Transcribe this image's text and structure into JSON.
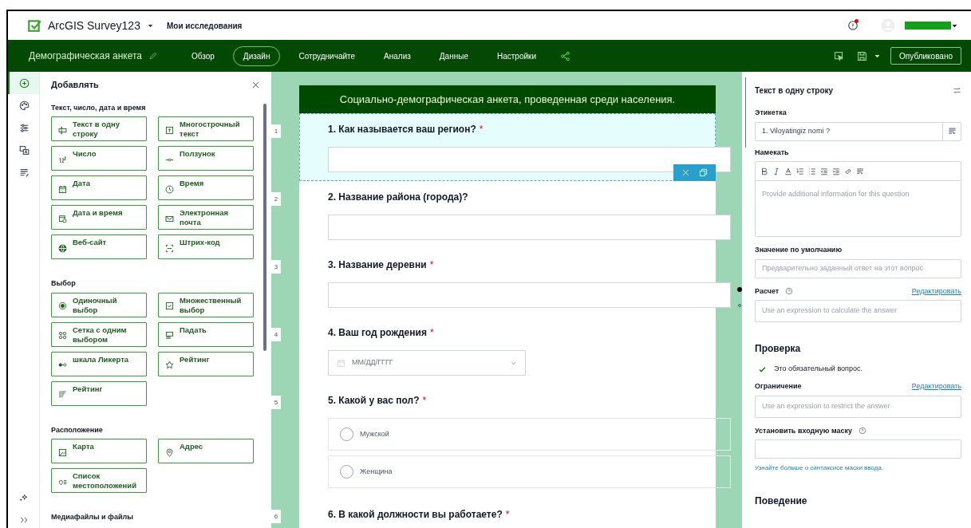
{
  "header": {
    "app_title": "ArcGIS Survey123",
    "my_surveys": "Мои исследования"
  },
  "navbar": {
    "survey_name": "Демографическая анкета",
    "tabs": [
      {
        "label": "Обзор",
        "selected": false
      },
      {
        "label": "Дизайн",
        "selected": true
      },
      {
        "label": "Сотрудничайте",
        "selected": false
      },
      {
        "label": "Анализ",
        "selected": false
      },
      {
        "label": "Данные",
        "selected": false
      },
      {
        "label": "Настройки",
        "selected": false
      }
    ],
    "publish_button": "Опубликовано"
  },
  "rail": {
    "items": [
      {
        "kind": "add",
        "selected": true
      },
      {
        "kind": "palette",
        "selected": false
      },
      {
        "kind": "sliders",
        "selected": false
      },
      {
        "kind": "translate",
        "selected": false
      },
      {
        "kind": "list",
        "selected": false
      }
    ],
    "bottom_items": [
      {
        "kind": "sparkle"
      },
      {
        "kind": "expand"
      }
    ]
  },
  "add_panel": {
    "title": "Добавлять",
    "sections": [
      {
        "title": "Текст, число, дата и время",
        "items": [
          {
            "label": "Текст в одну строку",
            "kind": "textline"
          },
          {
            "label": "Многострочный текст",
            "kind": "multiline"
          },
          {
            "label": "Число",
            "kind": "number"
          },
          {
            "label": "Ползунок",
            "kind": "slider"
          },
          {
            "label": "Дата",
            "kind": "date"
          },
          {
            "label": "Время",
            "kind": "time"
          },
          {
            "label": "Дата и время",
            "kind": "datetime"
          },
          {
            "label": "Электронная почта",
            "kind": "email"
          },
          {
            "label": "Веб-сайт",
            "kind": "web"
          },
          {
            "label": "Штрих-код",
            "kind": "barcode"
          }
        ]
      },
      {
        "title": "Выбор",
        "items": [
          {
            "label": "Одиночный выбор",
            "kind": "radio"
          },
          {
            "label": "Множественный выбор",
            "kind": "check"
          },
          {
            "label": "Сетка с одним выбором",
            "kind": "grid"
          },
          {
            "label": "Падать",
            "kind": "dropdown"
          },
          {
            "label": "шкала Ликерта",
            "kind": "likert"
          },
          {
            "label": "Рейтинг",
            "kind": "star"
          },
          {
            "label": "Рейтинг",
            "kind": "ranking"
          }
        ]
      },
      {
        "title": "Расположение",
        "items": [
          {
            "label": "Карта",
            "kind": "map"
          },
          {
            "label": "Адрес",
            "kind": "pin"
          },
          {
            "label": "Список местоположений",
            "kind": "loclist"
          }
        ]
      },
      {
        "title": "Медиафайлы и файлы"
      }
    ]
  },
  "canvas": {
    "form_title": "Социально-демографическая анкета, проведенная среди населения.",
    "questions": [
      {
        "number": "1",
        "label": "1. Как называется ваш регион?",
        "required_mark": "*",
        "kind": "text",
        "selected": true
      },
      {
        "number": "2",
        "label": "2. Название района (города)?",
        "kind": "text",
        "selected": false
      },
      {
        "number": "3",
        "label": "3. Название деревни",
        "required_mark": "*",
        "kind": "text",
        "selected": false
      },
      {
        "number": "4",
        "label": "4. Ваш год рождения",
        "required_mark": "*",
        "kind": "date",
        "placeholder": "ММ/ДД/ГГГГ",
        "selected": false
      },
      {
        "number": "5",
        "label": "5. Какой у вас пол?",
        "required_mark": "*",
        "kind": "radio",
        "options": [
          "Мужской",
          "Женщина"
        ],
        "selected": false
      },
      {
        "number": "6",
        "label": "6. В какой должности вы работаете?",
        "required_mark": "*",
        "kind": "partial",
        "selected": false
      }
    ]
  },
  "properties": {
    "title": "Текст в одну строку",
    "label_field": {
      "label": "Этикетка",
      "value": "1. Viloyatingiz nomi ?"
    },
    "hint_field": {
      "label": "Намекать",
      "placeholder": "Provide additional information for this question"
    },
    "default_field": {
      "label": "Значение по умолчанию",
      "placeholder": "Предварительно заданный ответ на этот вопрос"
    },
    "calculation": {
      "label": "Расчет",
      "link": "Редактировать",
      "placeholder": "Use an expression to calculate the answer"
    },
    "validation_title": "Проверка",
    "required_checkbox": {
      "label": "Это обязательный вопрос.",
      "checked": true
    },
    "constraint": {
      "label": "Ограничение",
      "link": "Редактировать",
      "placeholder": "Use an expression to restrict the answer"
    },
    "input_mask": {
      "label": "Установить входную маску",
      "help_link": "Узнайте больше о синтаксисе маски ввода."
    },
    "behavior_title": "Поведение"
  }
}
